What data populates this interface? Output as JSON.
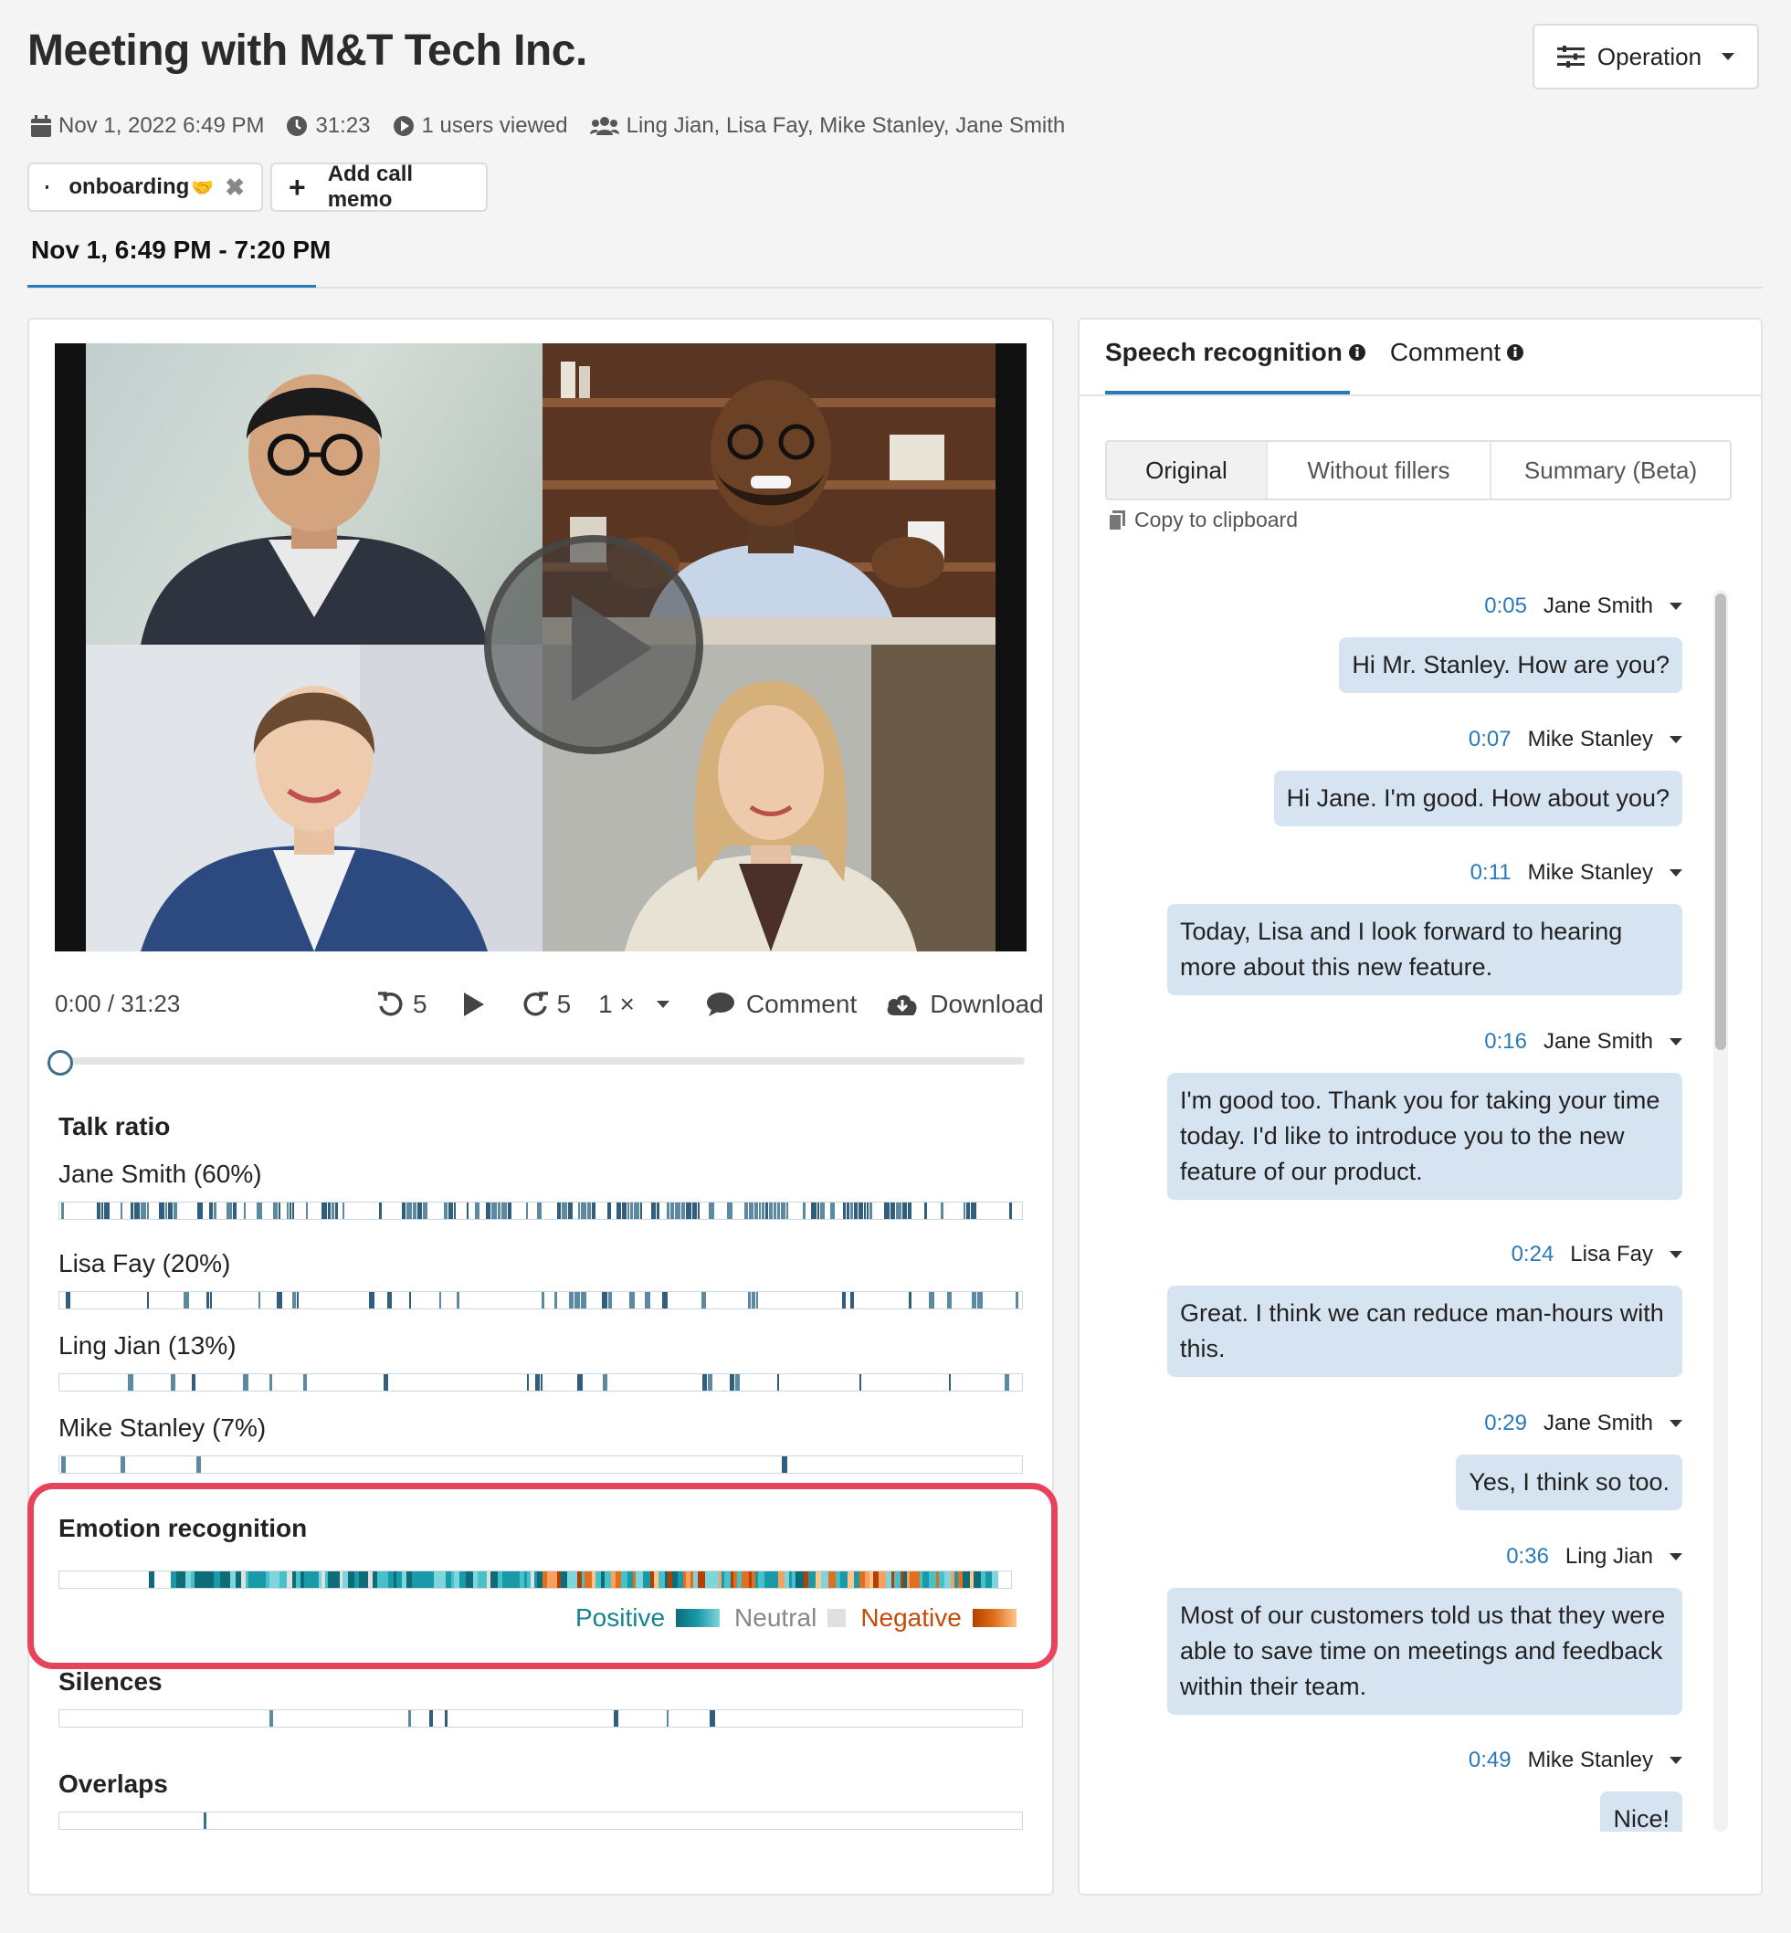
{
  "header": {
    "title": "Meeting with M&T Tech Inc.",
    "operation_label": "Operation",
    "meta": {
      "date": "Nov 1, 2022 6:49 PM",
      "duration": "31:23",
      "views": "1 users viewed",
      "participants": "Ling Jian, Lisa Fay, Mike Stanley, Jane Smith"
    },
    "tag_label": "onboarding",
    "tag_emoji": "🤝",
    "add_memo_label": "Add call memo",
    "date_tab": "Nov 1, 6:49 PM - 7:20 PM"
  },
  "player": {
    "time_readout": "0:00 / 31:23",
    "rewind_seconds": "5",
    "forward_seconds": "5",
    "speed": "1 ×",
    "comment_label": "Comment",
    "download_label": "Download",
    "progress": 0
  },
  "talk_ratio": {
    "title": "Talk ratio",
    "speakers": [
      {
        "label": "Jane Smith (60%)"
      },
      {
        "label": "Lisa Fay (20%)"
      },
      {
        "label": "Ling Jian (13%)"
      },
      {
        "label": "Mike Stanley (7%)"
      }
    ]
  },
  "emotion": {
    "title": "Emotion recognition",
    "legend": {
      "positive": "Positive",
      "neutral": "Neutral",
      "negative": "Negative"
    },
    "colors": {
      "positive": "#1a9aa8",
      "neutral": "#e0e0e0",
      "negative": "#e0701e"
    }
  },
  "silences": {
    "title": "Silences"
  },
  "overlaps": {
    "title": "Overlaps"
  },
  "right_panel": {
    "tabs": [
      "Speech recognition",
      "Comment"
    ],
    "modes": [
      "Original",
      "Without fillers",
      "Summary (Beta)"
    ],
    "copy_label": "Copy to clipboard",
    "transcript": [
      {
        "time": "0:05",
        "speaker": "Jane Smith",
        "text": "Hi Mr. Stanley. How are you?"
      },
      {
        "time": "0:07",
        "speaker": "Mike Stanley",
        "text": "Hi Jane. I'm good. How about you?"
      },
      {
        "time": "0:11",
        "speaker": "Mike Stanley",
        "text": "Today, Lisa and I look forward to hearing more about this new feature."
      },
      {
        "time": "0:16",
        "speaker": "Jane Smith",
        "text": "I'm good too. Thank you for taking your time today. I'd like to introduce you to the new feature of our product."
      },
      {
        "time": "0:24",
        "speaker": "Lisa Fay",
        "text": "Great. I think we can reduce man-hours with this."
      },
      {
        "time": "0:29",
        "speaker": "Jane Smith",
        "text": "Yes, I think so too."
      },
      {
        "time": "0:36",
        "speaker": "Ling Jian",
        "text": "Most of our customers told us that they were able to save time on meetings and feedback within their team."
      },
      {
        "time": "0:49",
        "speaker": "Mike Stanley",
        "text": "Nice!"
      }
    ]
  },
  "accent_color": "#2a7ab8",
  "highlight_color": "#e8435c"
}
